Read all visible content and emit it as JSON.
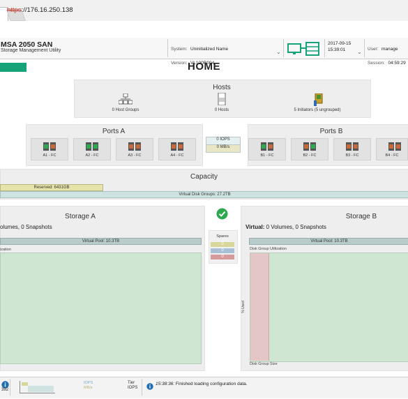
{
  "browser": {
    "url_scheme": "https",
    "url_rest": "://176.16.250.138"
  },
  "header": {
    "product_name": "MSA 2050 SAN",
    "product_subtitle": "Storage Management Utility",
    "system_label": "System:",
    "system_value": "Uninitialized Name",
    "version_label": "Version:",
    "version_value": "VL100R004",
    "date": "2017-09-15",
    "time": "15:39:01",
    "user_label": "User:",
    "user_value": "manage",
    "session_label": "Session:",
    "session_value": "04:59:29"
  },
  "page": {
    "title": "HOME"
  },
  "hosts": {
    "title": "Hosts",
    "host_groups": "0 Host Groups",
    "hosts": "0 Hosts",
    "initiators": "5 Initiators (5 ungrouped)"
  },
  "ports_a": {
    "title": "Ports A",
    "ports": [
      "A1 - FC",
      "A2 - FC",
      "A3 - FC",
      "A4 - FC"
    ]
  },
  "ports_b": {
    "title": "Ports B",
    "ports": [
      "B1 - FC",
      "B2 - FC",
      "B3 - FC",
      "B4 - FC"
    ]
  },
  "io_stats": {
    "iops": "0 IOPS",
    "mbs": "0 MB/s"
  },
  "capacity": {
    "title": "Capacity",
    "reserved": "Reserved: 6431GB",
    "virtual_disk_groups": "Virtual Disk Groups: 27.2TB"
  },
  "storage_a": {
    "title": "Storage A",
    "summary": "olumes, 0 Snapshots",
    "pool": "Virtual Pool: 10.3TB",
    "util_label": "ization"
  },
  "storage_b": {
    "title": "Storage B",
    "virtual_label": "Virtual:",
    "summary": "0 Volumes, 0 Snapshots",
    "pool": "Virtual Pool: 10.3TB",
    "util_label": "Disk Group Utilization",
    "axis_y": "% Used",
    "axis_x": "Disk Group Size"
  },
  "spares": {
    "title": "Spares",
    "values": [
      "0",
      "0",
      "0"
    ],
    "colors": [
      "#d8d79a",
      "#a9bfd6",
      "#d59a9a"
    ]
  },
  "footer": {
    "count": "392",
    "iops_label": "IOPS",
    "mbs_label": "MB/s",
    "tier_label": "Tier",
    "tier_iops": "IOPS",
    "message_time": "15:38:36:",
    "message_text": "Finished loading configuration data."
  },
  "colors": {
    "accent_green": "#17a37a",
    "util_green": "#cfe6d3",
    "util_pink": "#e4c6c6",
    "capacity_bar": "#cfe3e3"
  }
}
